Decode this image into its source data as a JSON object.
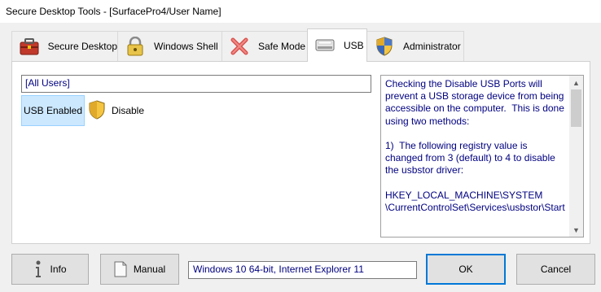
{
  "window": {
    "title": "Secure Desktop Tools - [SurfacePro4/User Name]"
  },
  "tabs": [
    {
      "label": "Secure Desktop",
      "icon": "toolbox-icon"
    },
    {
      "label": "Windows Shell",
      "icon": "padlock-icon"
    },
    {
      "label": "Safe Mode",
      "icon": "red-x-icon"
    },
    {
      "label": "USB",
      "icon": "usb-drive-icon",
      "active": true
    },
    {
      "label": "Administrator",
      "icon": "shield-icon"
    }
  ],
  "usb_panel": {
    "users_field": "[All Users]",
    "status_label": "USB Enabled",
    "disable_label": "Disable",
    "description": "Checking the Disable USB Ports will prevent a USB storage device from being accessible on the computer.  This is done using two methods:\n\n1)  The following registry value is changed from 3 (default) to 4 to disable the usbstor driver:\n\nHKEY_LOCAL_MACHINE\\SYSTEM\n\\CurrentControlSet\\Services\\usbstor\\Start"
  },
  "bottom": {
    "info_label": "Info",
    "manual_label": "Manual",
    "browser_info": "Windows 10 64-bit, Internet Explorer 11",
    "ok_label": "OK",
    "cancel_label": "Cancel"
  },
  "colors": {
    "accent": "#0078d7",
    "selected_bg": "#cce8ff",
    "text_blue": "#000080"
  }
}
